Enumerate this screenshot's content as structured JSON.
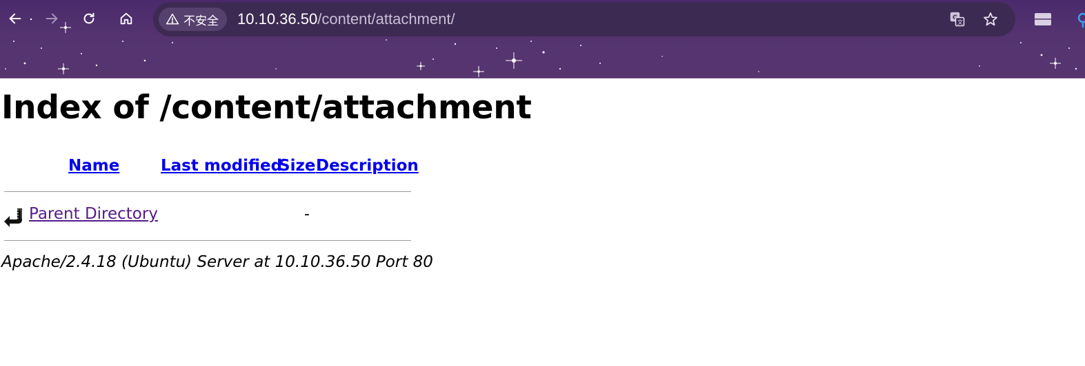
{
  "browser": {
    "security_label": "不安全",
    "url_host": "10.10.36.50",
    "url_path": "/content/attachment/",
    "icons": {
      "back": "arrow-left-icon",
      "forward": "arrow-right-icon",
      "reload": "reload-icon",
      "home": "home-icon",
      "warning": "warning-triangle-icon",
      "translate": "translate-icon",
      "bookmark": "star-icon",
      "sidebar": "tab-strip-icon"
    },
    "colors": {
      "theme": "#54336f",
      "omnibox": "#3d2a52"
    }
  },
  "page": {
    "title": "Index of /content/attachment",
    "columns": {
      "name": "Name",
      "last_modified": "Last modified",
      "size": "Size",
      "description": "Description"
    },
    "rows": [
      {
        "icon": "back-arrow-icon",
        "name": "Parent Directory",
        "last_modified": "",
        "size": "-",
        "description": ""
      }
    ],
    "address": "Apache/2.4.18 (Ubuntu) Server at 10.10.36.50 Port 80",
    "colors": {
      "link": "#0000ee",
      "visited_link": "#551a8b"
    }
  }
}
